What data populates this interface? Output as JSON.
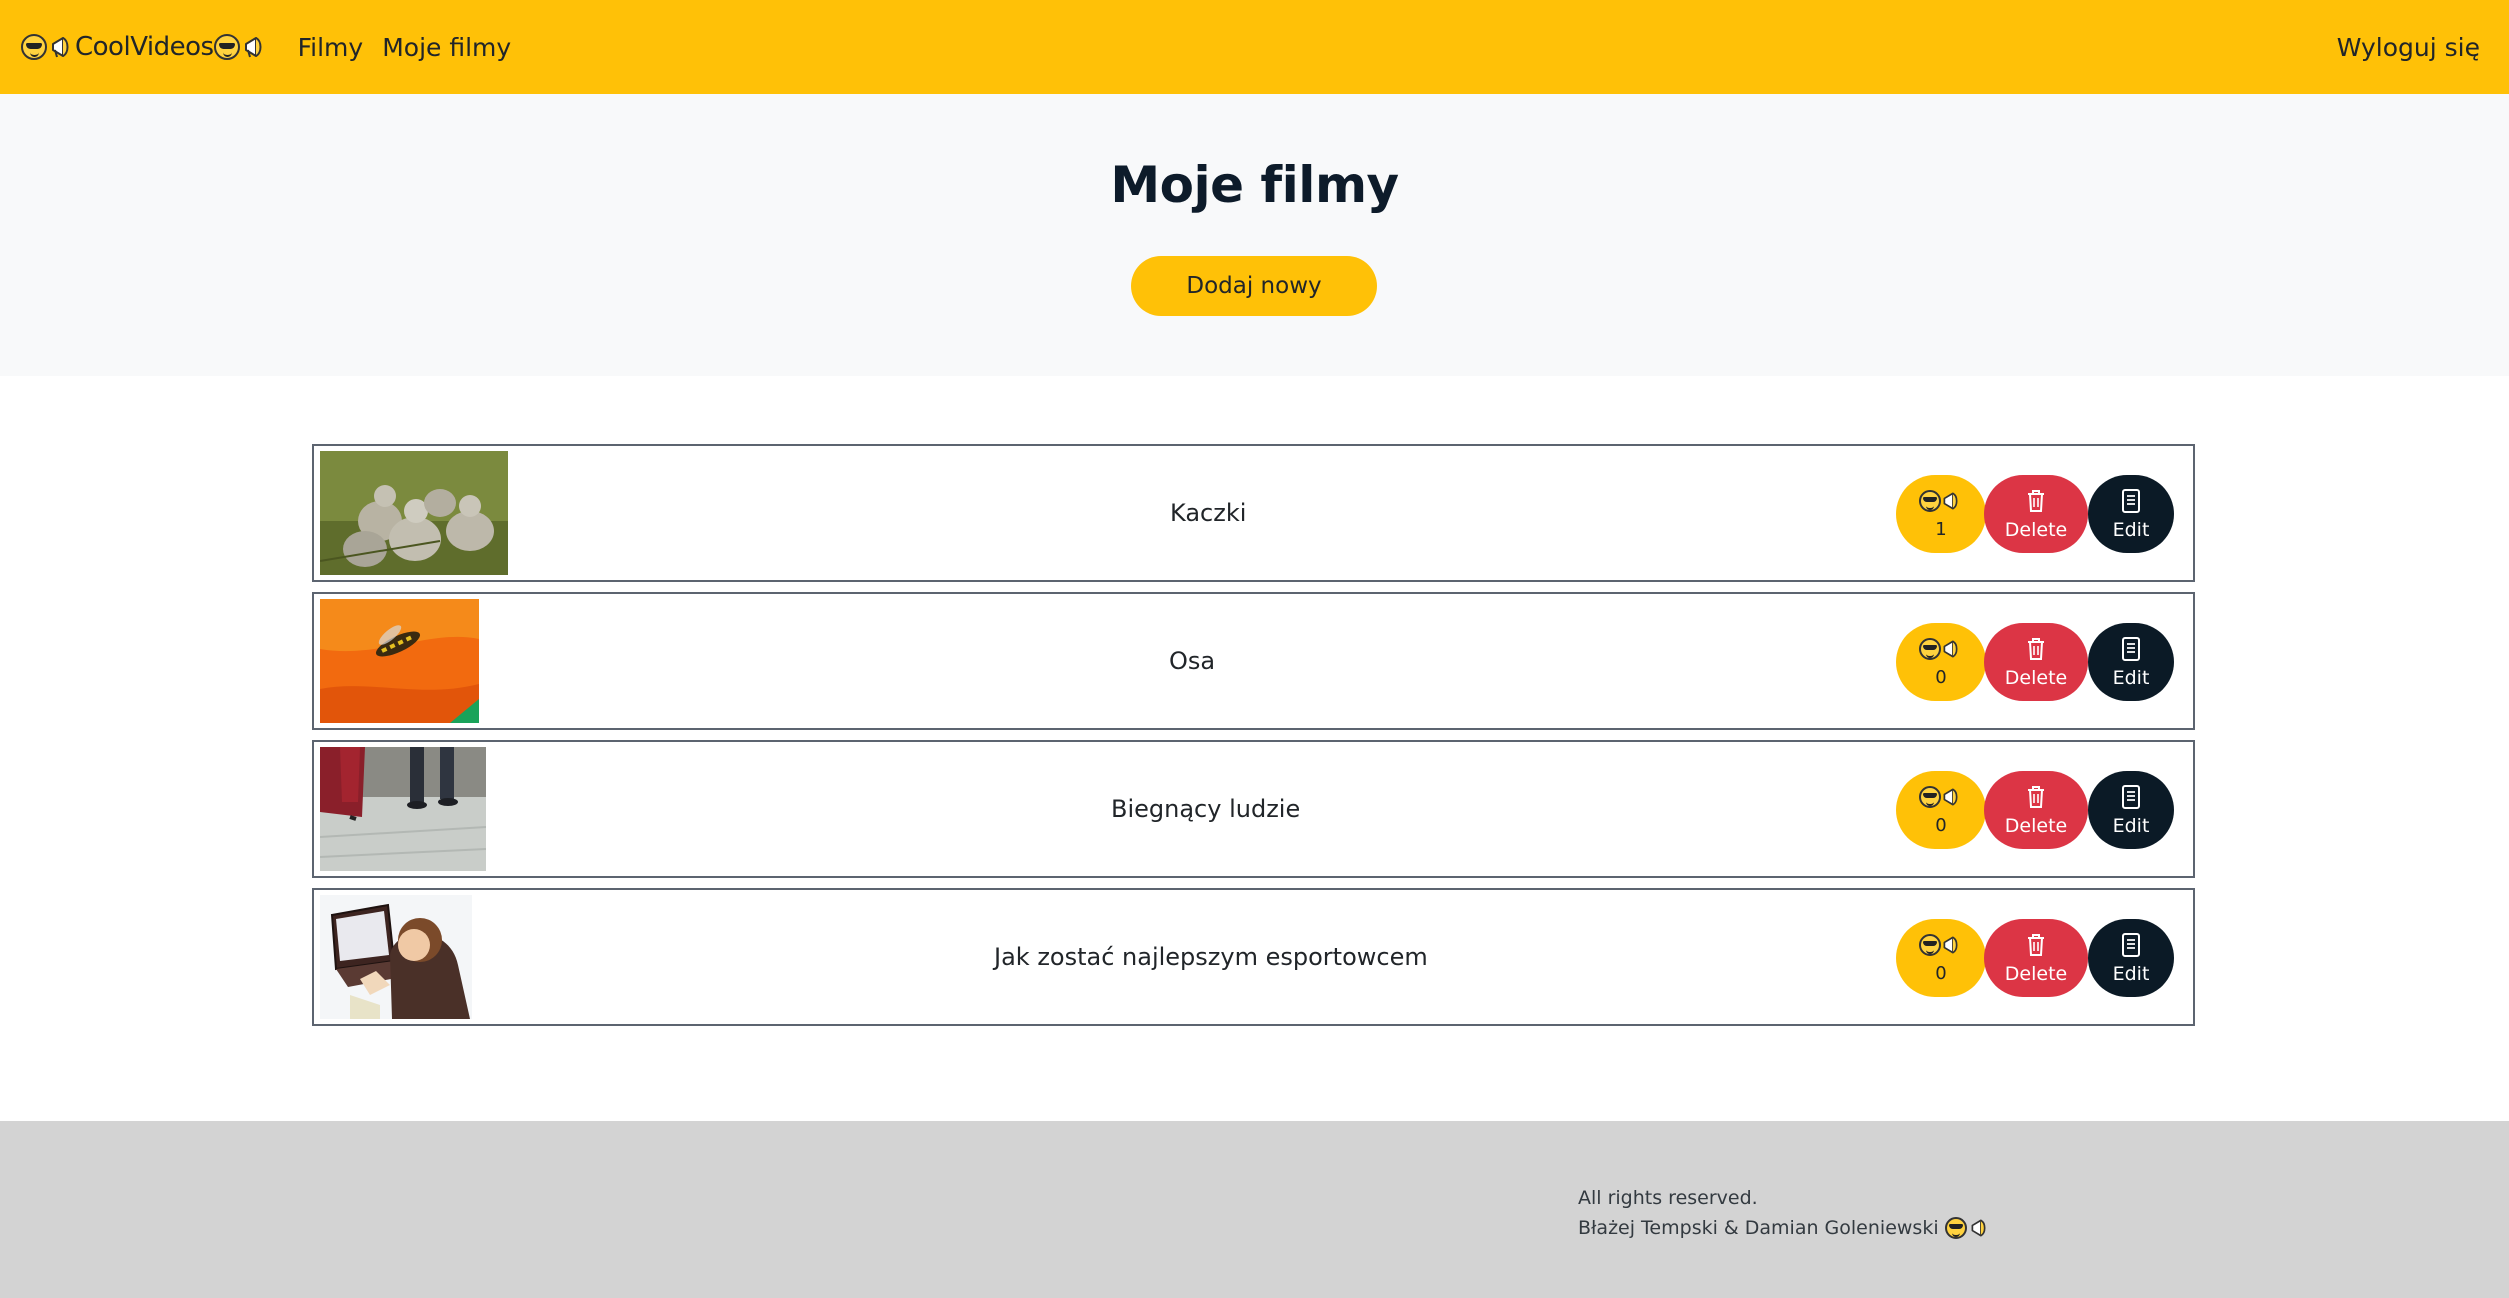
{
  "navbar": {
    "brand": "CoolVideos",
    "brand_icons": [
      "cool-face-icon",
      "megaphone-icon"
    ],
    "links": [
      "Filmy",
      "Moje filmy"
    ],
    "logout": "Wyloguj się",
    "color": "#ffc107"
  },
  "hero": {
    "title": "Moje filmy",
    "add_button": "Dodaj nowy"
  },
  "videos": [
    {
      "title": "Kaczki",
      "likes": "1",
      "thumb": "ducklings-image"
    },
    {
      "title": "Osa",
      "likes": "0",
      "thumb": "wasp-on-flower-image"
    },
    {
      "title": "Biegnący ludzie",
      "likes": "0",
      "thumb": "running-people-image"
    },
    {
      "title": "Jak zostać najlepszym esportowcem",
      "likes": "0",
      "thumb": "boy-with-laptop-image"
    }
  ],
  "actions": {
    "delete_label": "Delete",
    "edit_label": "Edit",
    "like_color": "#ffc107",
    "delete_color": "#dc3545",
    "edit_color": "#0b1a26"
  },
  "footer": {
    "line1": "All rights reserved.",
    "line2": "Błażej Tempski & Damian Goleniewski"
  }
}
